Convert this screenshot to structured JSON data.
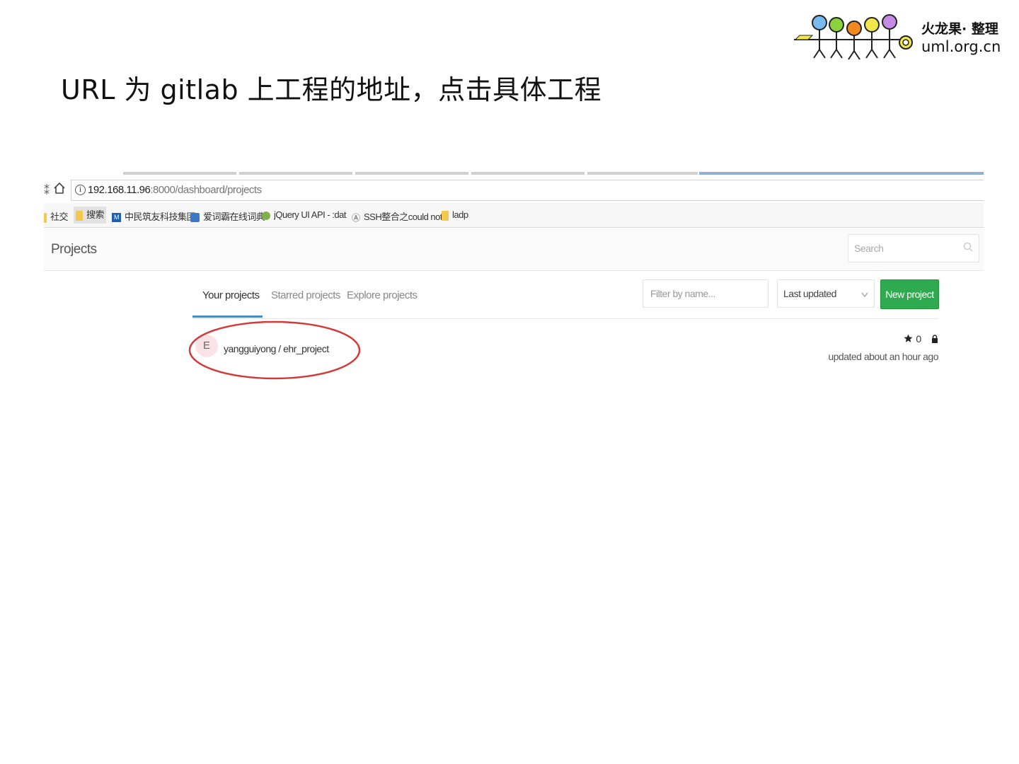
{
  "slide": {
    "title": "URL 为 gitlab 上工程的地址，点击具体工程"
  },
  "logo": {
    "name": "火龙果· 整理",
    "url": "uml.org.cn"
  },
  "browser": {
    "url_host": "192.168.11.96",
    "url_path": ":8000/dashboard/projects",
    "bookmarks": [
      {
        "label": "社交",
        "icon": "folder-icon"
      },
      {
        "label": "搜索",
        "icon": "folder-icon"
      },
      {
        "label": "中民筑友科技集团",
        "icon": "site-icon"
      },
      {
        "label": "爱词霸在线词典",
        "icon": "site-icon"
      },
      {
        "label": "jQuery UI API - :dat",
        "icon": "site-icon"
      },
      {
        "label": "SSH整合之could not",
        "icon": "site-icon"
      },
      {
        "label": "ladp",
        "icon": "folder-icon"
      }
    ]
  },
  "gitlab": {
    "header_title": "Projects",
    "search_placeholder": "Search",
    "tabs": [
      {
        "label": "Your projects",
        "active": true
      },
      {
        "label": "Starred projects",
        "active": false
      },
      {
        "label": "Explore projects",
        "active": false
      }
    ],
    "filter_placeholder": "Filter by name...",
    "sort_selected": "Last updated",
    "new_project_label": "New project",
    "projects": [
      {
        "avatar_letter": "E",
        "name": "yangguiyong / ehr_project",
        "stars": "0",
        "updated": "updated about an hour ago"
      }
    ]
  },
  "colors": {
    "new_button": "#2eaa4f",
    "active_tab_underline": "#4a8ac8",
    "annotation_ellipse": "#d23a3a"
  }
}
